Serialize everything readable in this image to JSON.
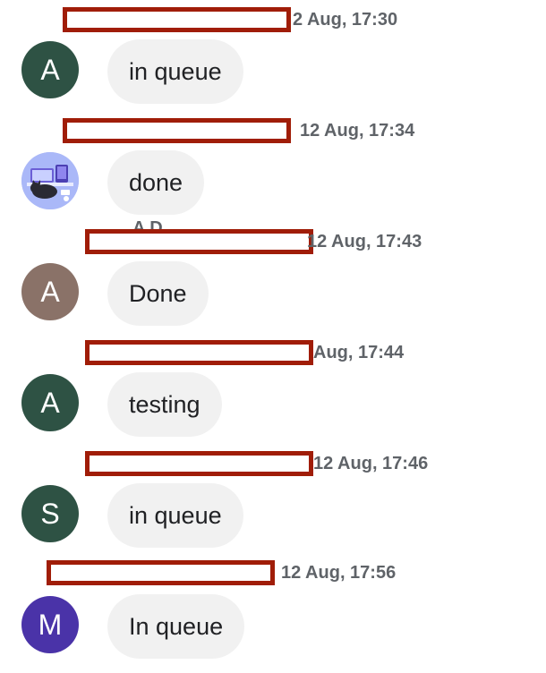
{
  "messages": [
    {
      "time": "2 Aug, 17:30",
      "avatar_letter": "A",
      "avatar_color": "#2e5244",
      "text": "in queue"
    },
    {
      "time": "12 Aug, 17:34",
      "avatar_letter": "",
      "avatar_image": "illustration-avatar",
      "text": "done"
    },
    {
      "time": "12 Aug, 17:43",
      "sender_partial": "A       D",
      "avatar_letter": "A",
      "avatar_color": "#8a7268",
      "text": "Done"
    },
    {
      "time": "Aug, 17:44",
      "avatar_letter": "A",
      "avatar_color": "#2e5244",
      "text": "testing"
    },
    {
      "time": "12 Aug, 17:46",
      "avatar_letter": "S",
      "avatar_color": "#2e5244",
      "text": "in queue"
    },
    {
      "time": "12 Aug, 17:56",
      "avatar_letter": "M",
      "avatar_color": "#4a33a8",
      "text": "In queue"
    }
  ],
  "colors": {
    "redaction_border": "#a01d08",
    "bubble_bg": "#f1f1f1",
    "timestamp": "#5f6368"
  }
}
